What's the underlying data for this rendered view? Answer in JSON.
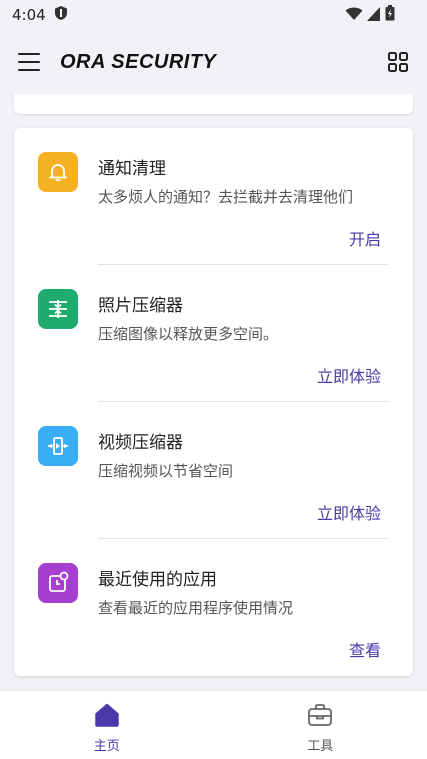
{
  "status_bar": {
    "time": "4:04"
  },
  "app_bar": {
    "title": "ORA SECURITY"
  },
  "features": [
    {
      "title": "通知清理",
      "description": "太多烦人的通知？去拦截并去清理他们",
      "action": "开启",
      "icon": "bell-icon",
      "color": "#f5b023"
    },
    {
      "title": "照片压缩器",
      "description": "压缩图像以释放更多空间。",
      "action": "立即体验",
      "icon": "compress-icon",
      "color": "#1faa6e"
    },
    {
      "title": "视频压缩器",
      "description": "压缩视频以节省空间",
      "action": "立即体验",
      "icon": "video-compress-icon",
      "color": "#3aaef5"
    },
    {
      "title": "最近使用的应用",
      "description": "查看最近的应用程序使用情况",
      "action": "查看",
      "icon": "recent-apps-icon",
      "color": "#a63fd0"
    }
  ],
  "bottom_nav": {
    "items": [
      {
        "label": "主页",
        "icon": "home-icon",
        "active": true
      },
      {
        "label": "工具",
        "icon": "toolbox-icon",
        "active": false
      }
    ]
  },
  "colors": {
    "accent": "#4a3aa8",
    "background": "#f2f2f6"
  }
}
